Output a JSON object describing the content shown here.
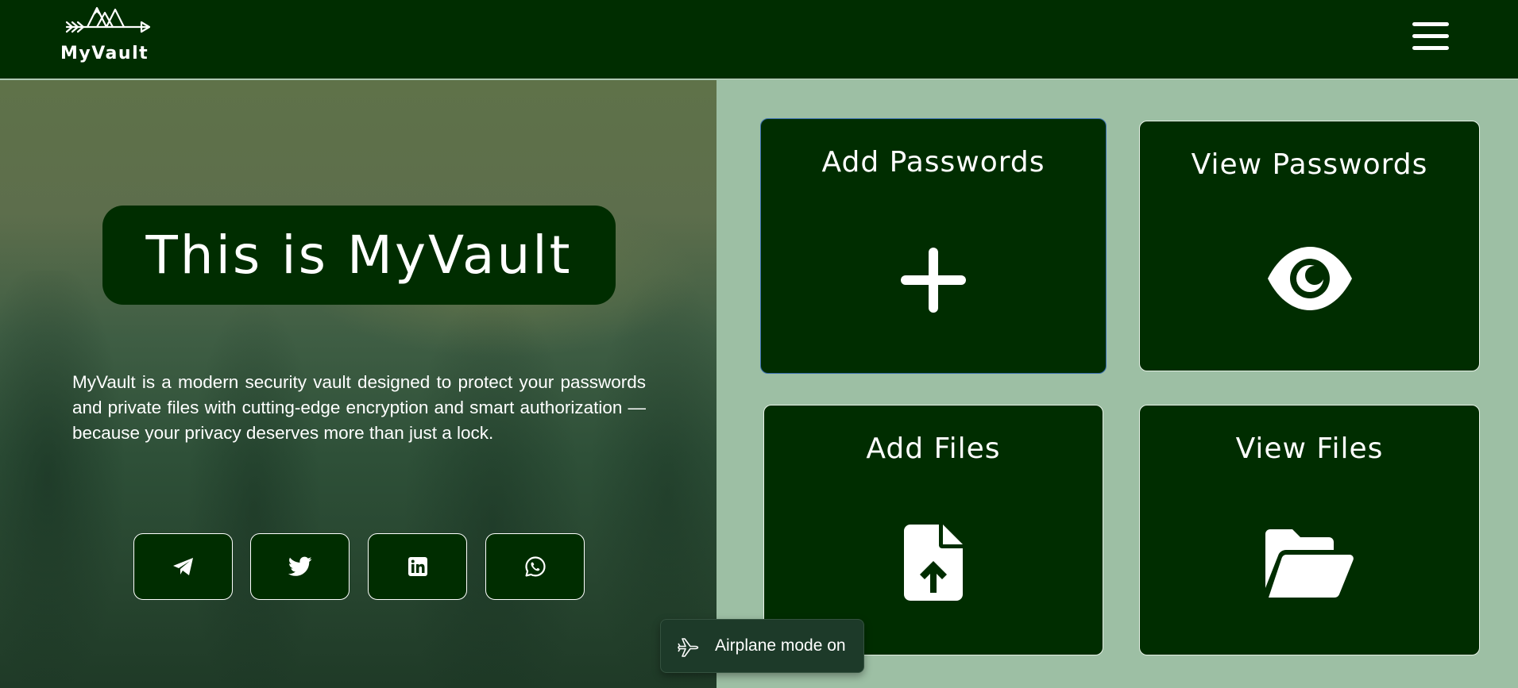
{
  "navbar": {
    "logo_text": "MyVault",
    "menu_icon": "hamburger-menu-icon"
  },
  "hero": {
    "title": "This is MyVault",
    "description": "MyVault is a modern security vault designed to protect your passwords and private files with cutting-edge encryption and smart authorization — because your privacy deserves more than just a lock.",
    "social_links": [
      {
        "icon": "telegram-icon"
      },
      {
        "icon": "twitter-icon"
      },
      {
        "icon": "linkedin-icon"
      },
      {
        "icon": "whatsapp-icon"
      }
    ]
  },
  "cards": [
    {
      "title": "Add Passwords",
      "icon": "plus-icon"
    },
    {
      "title": "View Passwords",
      "icon": "eye-icon"
    },
    {
      "title": "Add Files",
      "icon": "file-upload-icon"
    },
    {
      "title": "View Files",
      "icon": "folder-open-icon"
    }
  ],
  "toast": {
    "text": "Airplane mode on",
    "icon": "airplane-icon"
  },
  "colors": {
    "brand_dark_green": "#002d00",
    "dashboard_bg": "#9dbfa4",
    "text": "#ffffff",
    "focus_border": "#3c6fb0"
  }
}
